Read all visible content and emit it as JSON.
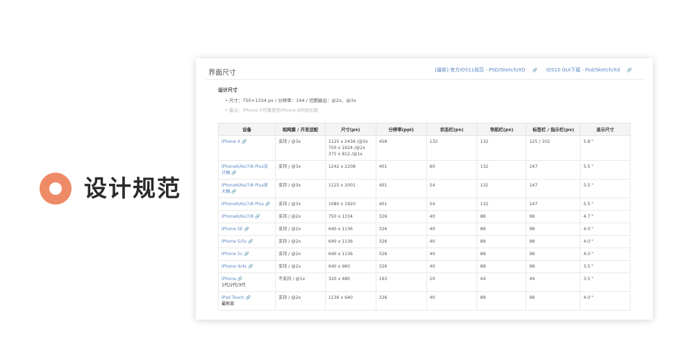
{
  "left_panel": {
    "heading": "设计规范"
  },
  "card": {
    "title": "界面尺寸",
    "links": [
      "[最新] 官方iOS11规范 - PSD/Sketch/XD",
      "iOS10 GUI下载 - Psd/Sketch/Xd"
    ],
    "spec_title": "设计尺寸",
    "spec_line": "• 尺寸：750×1334 px / 分辨率：144 / 切图输出：@2x、@3x",
    "spec_note": "• 备注：iPhone X可兼容至iPhone 8的加长版"
  },
  "table": {
    "headers": [
      "设备",
      "视网膜 / 开发适配",
      "尺寸(px)",
      "分辨率(ppi)",
      "状态栏(px)",
      "导航栏(px)",
      "标签栏 / 指示栏(px)",
      "显示尺寸"
    ],
    "rows": [
      {
        "device": "iPhone X",
        "device_sub": "",
        "retina": "支持 / @3x",
        "size_lines": [
          "1125 x 2436 /@3x",
          "750 x 1624 /@2x",
          "375 x 812 /@1x"
        ],
        "ppi": "458",
        "status": "132",
        "nav": "132",
        "tab": "125 / 102",
        "display": "5.8 \""
      },
      {
        "device": "iPhone6/6s/7/8 Plus设计稿",
        "device_sub": "",
        "retina": "支持 / @3x",
        "size_lines": [
          "1242 x 2208"
        ],
        "ppi": "401",
        "status": "60",
        "nav": "132",
        "tab": "147",
        "display": "5.5 \""
      },
      {
        "device": "iPhone6/6s/7/8 Plus放大稿",
        "device_sub": "",
        "retina": "支持 / @3x",
        "size_lines": [
          "1125 x 2001"
        ],
        "ppi": "401",
        "status": "54",
        "nav": "132",
        "tab": "147",
        "display": "5.5 \""
      },
      {
        "device": "iPhone6/6s/7/8 Plus",
        "device_sub": "",
        "retina": "支持 / @3x",
        "size_lines": [
          "1080 x 1920"
        ],
        "ppi": "401",
        "status": "54",
        "nav": "132",
        "tab": "147",
        "display": "5.5 \""
      },
      {
        "device": "iPhone6/6s/7/8",
        "device_sub": "",
        "retina": "支持 / @2x",
        "size_lines": [
          "750 x 1334"
        ],
        "ppi": "326",
        "status": "40",
        "nav": "88",
        "tab": "98",
        "display": "4.7 \""
      },
      {
        "device": "iPhone SE",
        "device_sub": "",
        "retina": "支持 / @2x",
        "size_lines": [
          "640 x 1136"
        ],
        "ppi": "326",
        "status": "40",
        "nav": "88",
        "tab": "98",
        "display": "4.0 \""
      },
      {
        "device": "iPhone 5/5s",
        "device_sub": "",
        "retina": "支持 / @2x",
        "size_lines": [
          "640 x 1136"
        ],
        "ppi": "326",
        "status": "40",
        "nav": "88",
        "tab": "98",
        "display": "4.0 \""
      },
      {
        "device": "iPhone 5c",
        "device_sub": "",
        "retina": "支持 / @2x",
        "size_lines": [
          "640 x 1136"
        ],
        "ppi": "326",
        "status": "40",
        "nav": "88",
        "tab": "98",
        "display": "4.0 \""
      },
      {
        "device": "iPhone 4/4s",
        "device_sub": "",
        "retina": "支持 / @2x",
        "size_lines": [
          "640 x 960"
        ],
        "ppi": "326",
        "status": "40",
        "nav": "88",
        "tab": "98",
        "display": "3.5 \""
      },
      {
        "device": "iPhone",
        "device_sub": "1代/2代/3代",
        "retina": "不支持 / @1x",
        "size_lines": [
          "320 x 480"
        ],
        "ppi": "163",
        "status": "20",
        "nav": "44",
        "tab": "49",
        "display": "3.5 \""
      },
      {
        "device": "iPod Touch",
        "device_sub": "最新款",
        "retina": "支持 / @2x",
        "size_lines": [
          "1136 x 640"
        ],
        "ppi": "326",
        "status": "40",
        "nav": "88",
        "tab": "98",
        "display": "4.0 \""
      }
    ]
  },
  "colors": {
    "accent": "#ee8a66",
    "link": "#5b86c5"
  },
  "icons": {
    "ring": "ring-icon",
    "link": "link-icon"
  }
}
